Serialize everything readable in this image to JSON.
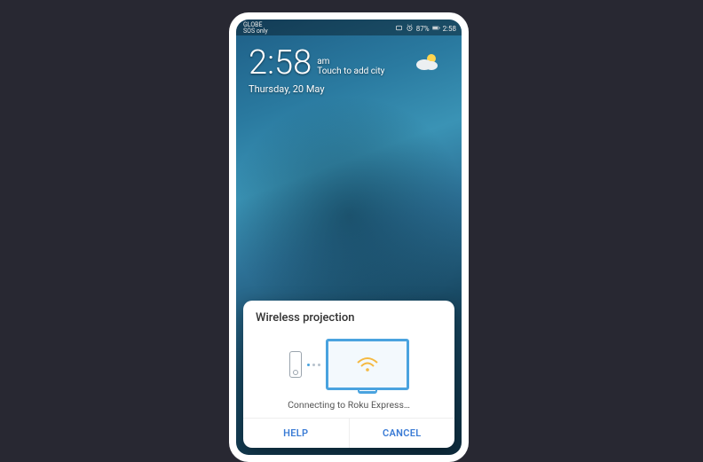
{
  "status": {
    "carrier": "GLOBE",
    "carrier_sub": "SOS only",
    "battery": "87%",
    "time": "2:58"
  },
  "clock": {
    "time": "2:58",
    "ampm": "am",
    "add_city": "Touch to add city",
    "date": "Thursday, 20 May"
  },
  "dialog": {
    "title": "Wireless projection",
    "status_text": "Connecting to Roku Express…",
    "help": "HELP",
    "cancel": "CANCEL"
  }
}
